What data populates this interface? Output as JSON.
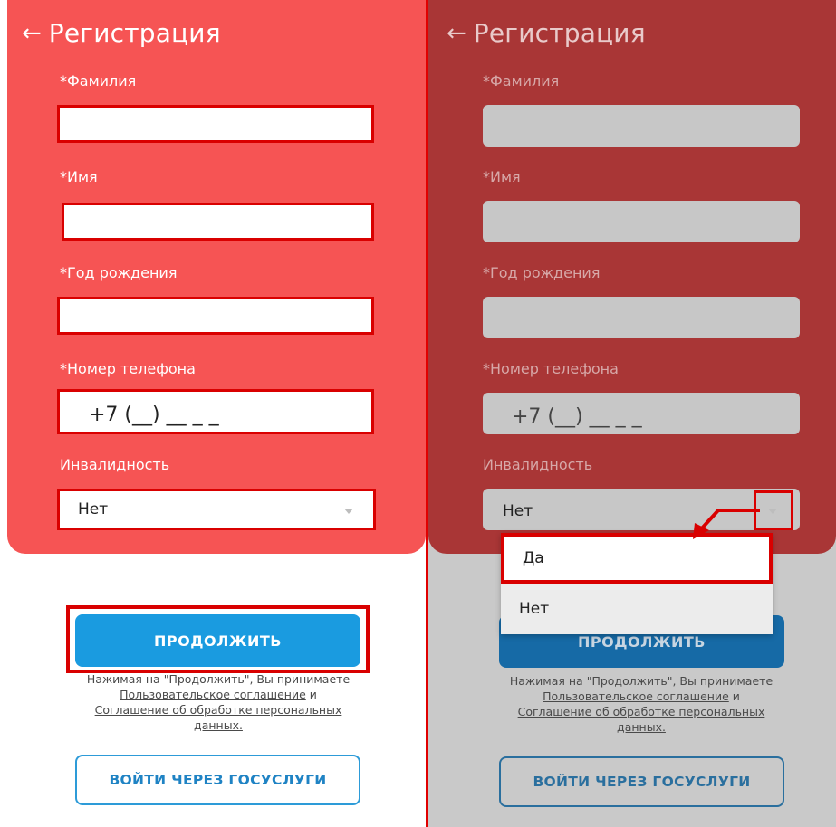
{
  "screen": {
    "title": "Регистрация",
    "fields": {
      "last_name_label": "*Фамилия",
      "first_name_label": "*Имя",
      "birth_year_label": "*Год рождения",
      "phone_label": "*Номер телефона",
      "phone_value": "+7 (__) __ _ _",
      "disability_label": "Инвалидность",
      "disability_value": "Нет"
    },
    "continue_button": "ПРОДОЛЖИТЬ",
    "agreement": {
      "prefix": "Нажимая на \"Продолжить\", Вы принимаете",
      "link1": "Пользовательское соглашение",
      "and": " и",
      "link2": "Соглашение об обработке персональных данных."
    },
    "gosuslugi_button": "ВОЙТИ ЧЕРЕЗ ГОСУСЛУГИ"
  },
  "dropdown": {
    "options": [
      "Да",
      "Нет"
    ]
  },
  "icons": {
    "back": "arrow-left-icon",
    "caret": "chevron-down-icon"
  },
  "colors": {
    "header_left": "#f65454",
    "header_right": "#a93636",
    "highlight": "#d90000",
    "primary_button": "#1a9be0"
  }
}
